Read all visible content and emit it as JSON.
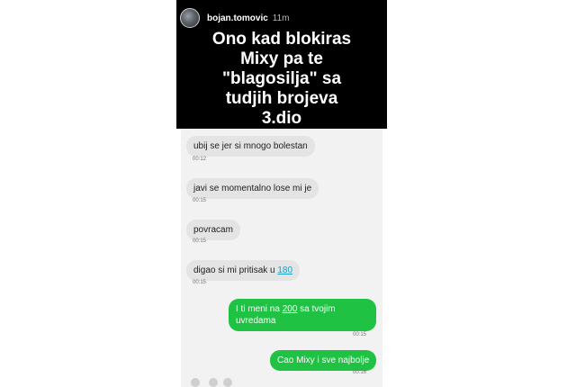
{
  "story": {
    "username": "bojan.tomovic",
    "time": "11m",
    "caption_lines": [
      "Ono kad blokiras",
      "Mixy pa te",
      "\"blagosilja\" sa",
      "tudjih brojeva",
      "3.dio"
    ]
  },
  "messages": [
    {
      "text": "ubij se jer si mnogo bolestan",
      "time": "00:12"
    },
    {
      "text": "javi se momentalno lose mi je",
      "time": "00:15"
    },
    {
      "text": "povracam",
      "time": "00:15"
    },
    {
      "text_before": "digao si mi pritisak u ",
      "link": "180",
      "time": "00:15"
    },
    {
      "text_before": "I ti meni na ",
      "link": "200",
      "text_after": " sa tvojim uvredama",
      "time": "00:15"
    },
    {
      "text": "Cao Mixy i sve najbolje",
      "time": "00:16"
    }
  ],
  "colors": {
    "incoming_bubble": "#e4e4e4",
    "outgoing_bubble": "#1fc243",
    "link": "#1a9fc6"
  }
}
